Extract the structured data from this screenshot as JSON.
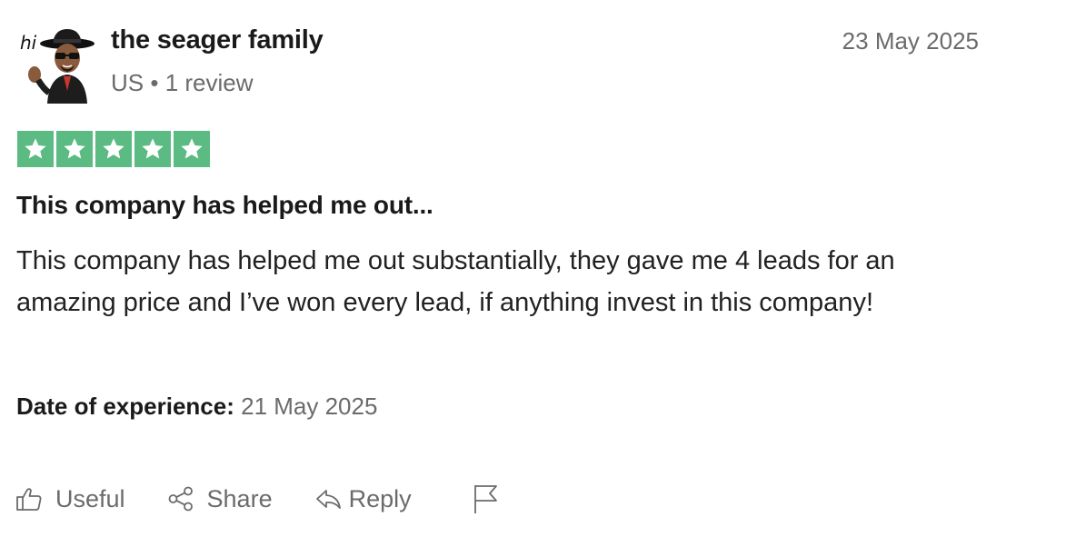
{
  "review": {
    "author_name": "the seager family",
    "author_country": "US",
    "author_separator": "•",
    "author_review_count": "1 review",
    "avatar_caption": "hi",
    "date": "23 May 2025",
    "rating": 5,
    "rating_max": 5,
    "star_color": "#5bbb83",
    "title": "This company has helped me out...",
    "body": "This company has helped me out substantially, they gave me 4 leads for an amazing price and I’ve won every lead, if anything invest in this company!",
    "experience_label": "Date of experience:",
    "experience_date": "21 May 2025"
  },
  "actions": {
    "useful": {
      "label": "Useful",
      "icon": "thumbs-up-icon"
    },
    "share": {
      "label": "Share",
      "icon": "share-icon"
    },
    "reply": {
      "label": "Reply",
      "icon": "reply-icon"
    },
    "report": {
      "icon": "flag-icon"
    }
  }
}
